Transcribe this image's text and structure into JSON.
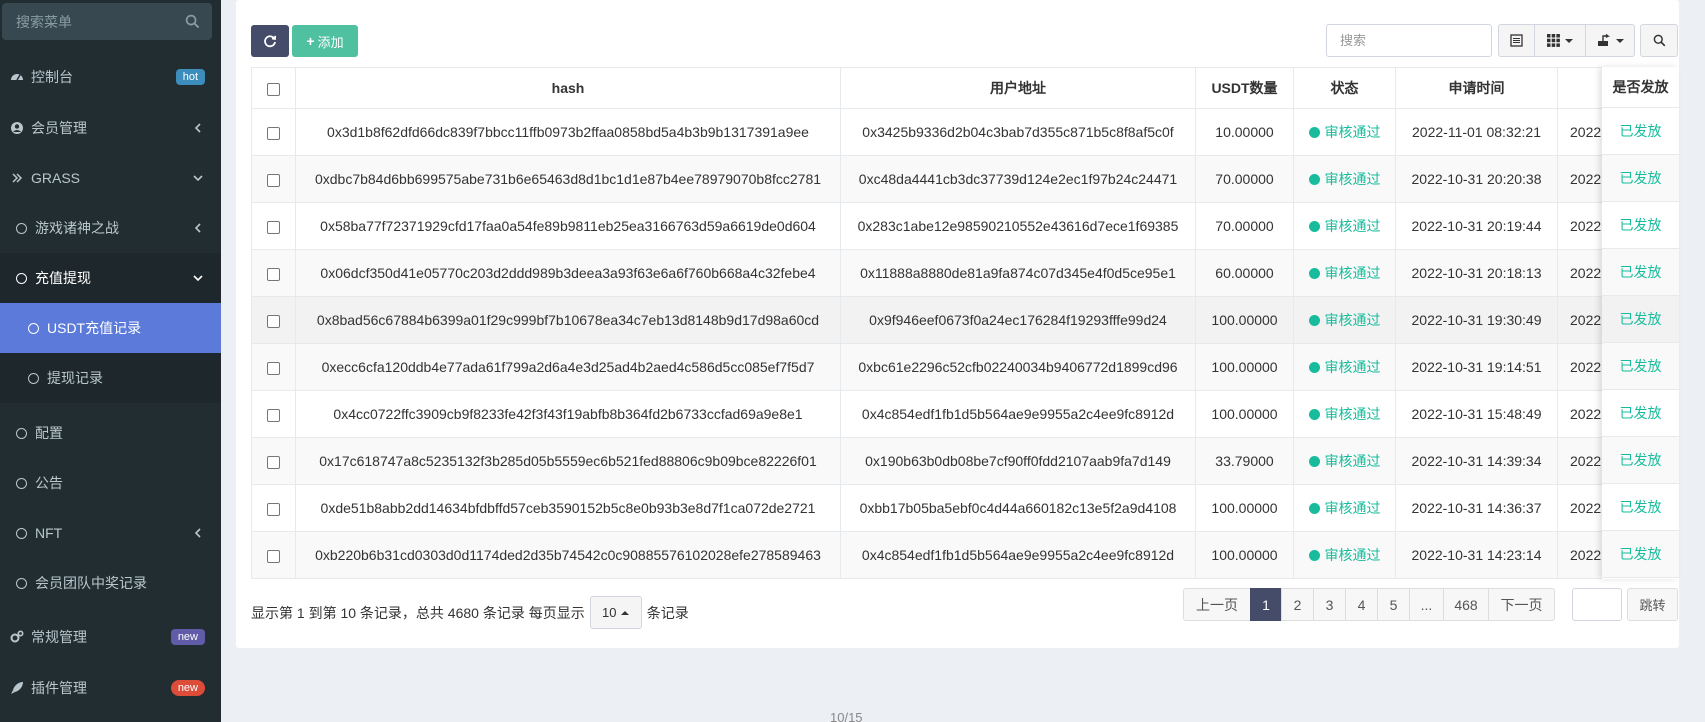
{
  "sidebar": {
    "search_placeholder": "搜索菜单",
    "items": [
      {
        "label": "控制台",
        "badge": "hot"
      },
      {
        "label": "会员管理"
      },
      {
        "label": "GRASS"
      },
      {
        "label": "游戏诸神之战"
      },
      {
        "label": "充值提现"
      },
      {
        "label": "USDT充值记录"
      },
      {
        "label": "提现记录"
      },
      {
        "label": "配置"
      },
      {
        "label": "公告"
      },
      {
        "label": "NFT"
      },
      {
        "label": "会员团队中奖记录"
      },
      {
        "label": "常规管理",
        "badge": "new"
      },
      {
        "label": "插件管理",
        "badge": "new"
      }
    ]
  },
  "toolbar": {
    "add_label": "添加",
    "search_placeholder": "搜索"
  },
  "table": {
    "headers": {
      "hash": "hash",
      "address": "用户地址",
      "amount": "USDT数量",
      "status": "状态",
      "apply_time": "申请时间",
      "issued": "是否发放"
    },
    "rows": [
      {
        "hash": "0x3d1b8f62dfd66dc839f7bbcc11ffb0973b2ffaa0858bd5a4b3b9b1317391a9ee",
        "address": "0x3425b9336d2b04c3bab7d355c871b5c8f8af5c0f",
        "amount": "10.00000",
        "status": "审核通过",
        "apply_time": "2022-11-01 08:32:21",
        "extra": "2022",
        "issued": "已发放"
      },
      {
        "hash": "0xdbc7b84d6bb699575abe731b6e65463d8d1bc1d1e87b4ee78979070b8fcc2781",
        "address": "0xc48da4441cb3dc37739d124e2ec1f97b24c24471",
        "amount": "70.00000",
        "status": "审核通过",
        "apply_time": "2022-10-31 20:20:38",
        "extra": "2022",
        "issued": "已发放"
      },
      {
        "hash": "0x58ba77f72371929cfd17faa0a54fe89b9811eb25ea3166763d59a6619de0d604",
        "address": "0x283c1abe12e98590210552e43616d7ece1f69385",
        "amount": "70.00000",
        "status": "审核通过",
        "apply_time": "2022-10-31 20:19:44",
        "extra": "2022",
        "issued": "已发放"
      },
      {
        "hash": "0x06dcf350d41e05770c203d2ddd989b3deea3a93f63e6a6f760b668a4c32febe4",
        "address": "0x11888a8880de81a9fa874c07d345e4f0d5ce95e1",
        "amount": "60.00000",
        "status": "审核通过",
        "apply_time": "2022-10-31 20:18:13",
        "extra": "2022",
        "issued": "已发放"
      },
      {
        "hash": "0x8bad56c67884b6399a01f29c999bf7b10678ea34c7eb13d8148b9d17d98a60cd",
        "address": "0x9f946eef0673f0a24ec176284f19293fffe99d24",
        "amount": "100.00000",
        "status": "审核通过",
        "apply_time": "2022-10-31 19:30:49",
        "extra": "2022",
        "issued": "已发放"
      },
      {
        "hash": "0xecc6cfa120ddb4e77ada61f799a2d6a4e3d25ad4b2aed4c586d5cc085ef7f5d7",
        "address": "0xbc61e2296c52cfb02240034b9406772d1899cd96",
        "amount": "100.00000",
        "status": "审核通过",
        "apply_time": "2022-10-31 19:14:51",
        "extra": "2022",
        "issued": "已发放"
      },
      {
        "hash": "0x4cc0722ffc3909cb9f8233fe42f3f43f19abfb8b364fd2b6733ccfad69a9e8e1",
        "address": "0x4c854edf1fb1d5b564ae9e9955a2c4ee9fc8912d",
        "amount": "100.00000",
        "status": "审核通过",
        "apply_time": "2022-10-31 15:48:49",
        "extra": "2022",
        "issued": "已发放"
      },
      {
        "hash": "0x17c618747a8c5235132f3b285d05b5559ec6b521fed88806c9b09bce82226f01",
        "address": "0x190b63b0db08be7cf90ff0fdd2107aab9fa7d149",
        "amount": "33.79000",
        "status": "审核通过",
        "apply_time": "2022-10-31 14:39:34",
        "extra": "2022",
        "issued": "已发放"
      },
      {
        "hash": "0xde51b8abb2dd14634bfdbffd57ceb3590152b5c8e0b93b3e8d7f1ca072de2721",
        "address": "0xbb17b05ba5ebf0c4d44a660182c13e5f2a9d4108",
        "amount": "100.00000",
        "status": "审核通过",
        "apply_time": "2022-10-31 14:36:37",
        "extra": "2022",
        "issued": "已发放"
      },
      {
        "hash": "0xb220b6b31cd0303d0d1174ded2d35b74542c0c90885576102028efe278589463",
        "address": "0x4c854edf1fb1d5b564ae9e9955a2c4ee9fc8912d",
        "amount": "100.00000",
        "status": "审核通过",
        "apply_time": "2022-10-31 14:23:14",
        "extra": "2022",
        "issued": "已发放"
      }
    ]
  },
  "pagination": {
    "info_prefix": "显示第 1 到第 10 条记录，总共 4680 条记录 每页显示",
    "page_size": "10",
    "info_suffix": "条记录",
    "prev": "上一页",
    "pages": [
      "1",
      "2",
      "3",
      "4",
      "5",
      "...",
      "468"
    ],
    "next": "下一页",
    "jump": "跳转"
  },
  "footer": {
    "page_indicator": "10/15"
  },
  "colors": {
    "sidebar_bg": "#222d32",
    "selected": "#5b7ada",
    "success": "#18bc9c",
    "primary_dark": "#444c69"
  }
}
